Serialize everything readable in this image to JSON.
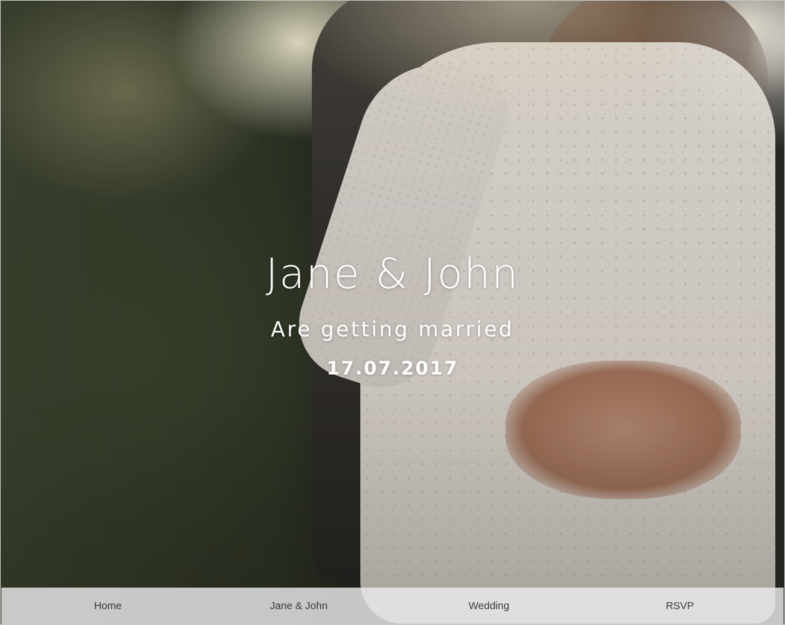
{
  "hero": {
    "names": "Jane & John",
    "tagline": "Are getting married",
    "date": "17.07.2017",
    "background_photo": "couple-embrace-photo"
  },
  "nav": {
    "items": [
      {
        "label": "Home"
      },
      {
        "label": "Jane & John"
      },
      {
        "label": "Wedding"
      },
      {
        "label": "RSVP"
      }
    ]
  },
  "colors": {
    "heading_text": "#ffffff",
    "nav_background": "#ebebeb",
    "nav_text": "#3a3a3a"
  }
}
